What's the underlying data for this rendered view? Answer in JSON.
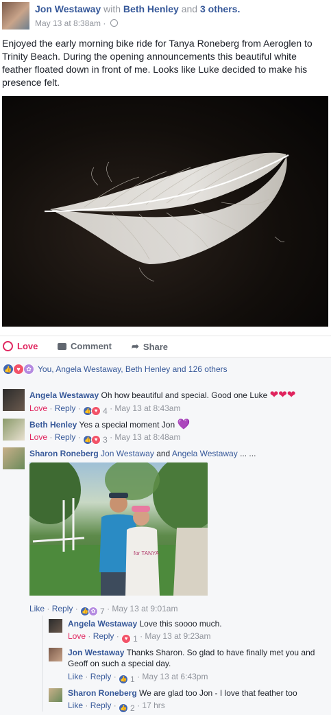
{
  "post": {
    "author": "Jon Westaway",
    "with_text": "with",
    "tagged": "Beth Henley",
    "and_text": "and",
    "others": "3 others.",
    "timestamp": "May 13 at 8:38am",
    "text": "Enjoyed the early morning bike ride for Tanya Roneberg from Aeroglen to Trinity Beach. During the opening announcements this beautiful white feather floated down in front of me. Looks like Luke decided to make his presence felt."
  },
  "actions": {
    "love": "Love",
    "comment": "Comment",
    "share": "Share"
  },
  "reactions_summary": "You, Angela Westaway, Beth Henley and 126 others",
  "comments": [
    {
      "author": "Angela Westaway",
      "text": "Oh how beautiful and special. Good one Luke",
      "emoji": "❤❤❤",
      "action": "Love",
      "reply": "Reply",
      "count": "4",
      "time": "May 13 at 8:43am"
    },
    {
      "author": "Beth Henley",
      "text": "Yes a special moment Jon",
      "emoji": "💜",
      "action": "Love",
      "reply": "Reply",
      "count": "3",
      "time": "May 13 at 8:48am"
    },
    {
      "author": "Sharon Roneberg",
      "tag1": "Jon Westaway",
      "and_text": "and",
      "tag2": "Angela Westaway",
      "ellipsis": "... ...",
      "action": "Like",
      "reply": "Reply",
      "count": "7",
      "time": "May 13 at 9:01am",
      "photo_text": "for TANYA"
    }
  ],
  "replies": [
    {
      "author": "Angela Westaway",
      "text": "Love this soooo much.",
      "action": "Love",
      "reply": "Reply",
      "count": "1",
      "time": "May 13 at 9:23am"
    },
    {
      "author": "Jon Westaway",
      "text_line1": "Thanks Sharon. So glad to have finally met you and",
      "text_line2": "Geoff on such a special day.",
      "action": "Like",
      "reply": "Reply",
      "count": "1",
      "time": "May 13 at 6:43pm"
    },
    {
      "author": "Sharon Roneberg",
      "text": "We are glad too Jon - I love that feather too",
      "action": "Like",
      "reply": "Reply",
      "count": "2",
      "time": "17 hrs"
    }
  ],
  "colors": {
    "link": "#365899",
    "love": "#e0245e",
    "like_blue": "#4267b2",
    "muted": "#90949c"
  }
}
